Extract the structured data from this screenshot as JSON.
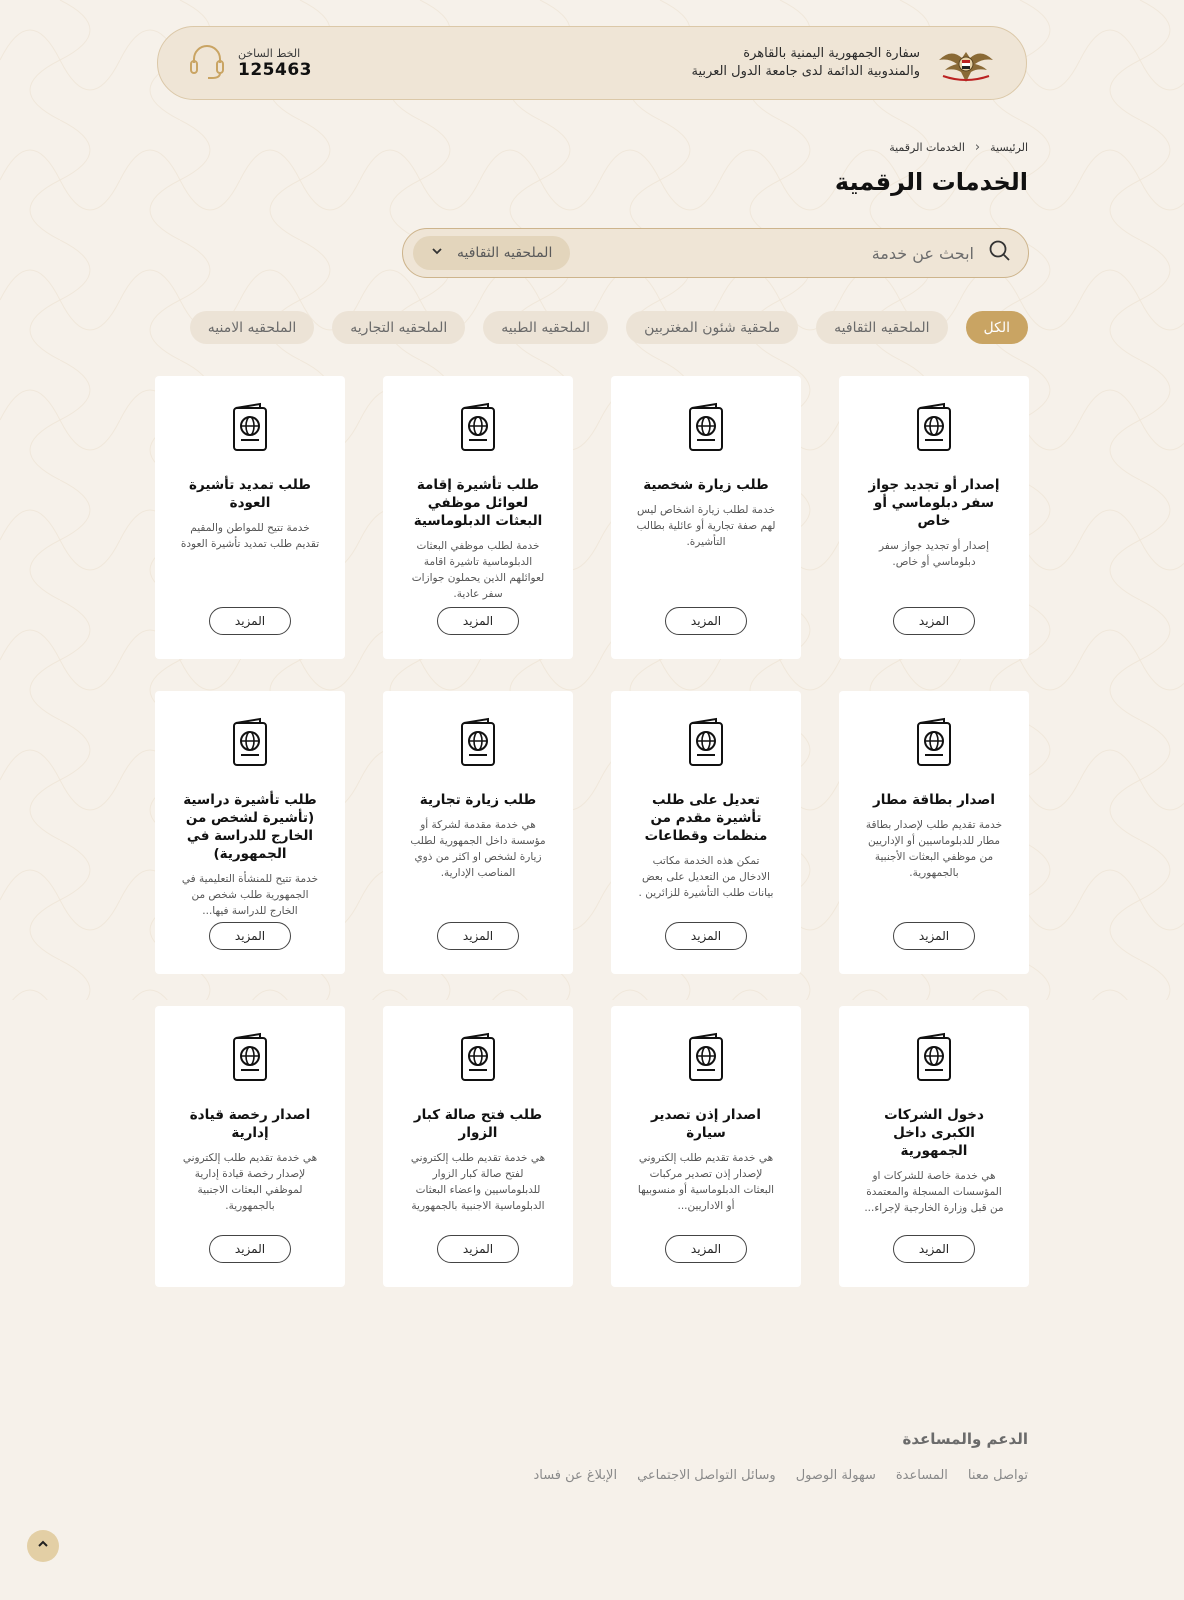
{
  "header": {
    "embassy_line1": "سفارة الجمهورية اليمنية بالقاهرة",
    "embassy_line2": "والمندوبية الدائمة لدى جامعة الدول العربية",
    "hotline_label": "الخط الساخن",
    "hotline_number": "125463"
  },
  "breadcrumb": {
    "home": "الرئيسية",
    "current": "الخدمات الرقمية"
  },
  "page_title": "الخدمات الرقمية",
  "search": {
    "placeholder": "ابحث عن خدمة",
    "selected_category": "الملحقيه الثقافيه"
  },
  "filters": [
    "الكل",
    "الملحقيه الثقافيه",
    "ملحقية شئون المغتربين",
    "الملحقيه الطبيه",
    "الملحقيه التجاريه",
    "الملحقيه الامنيه"
  ],
  "more_label": "المزيد",
  "cards": [
    {
      "title": "إصدار أو تجديد جواز سفر دبلوماسي أو خاص",
      "desc": "إصدار أو تجديد جواز سفر دبلوماسي أو خاص."
    },
    {
      "title": "طلب زيارة شخصية",
      "desc": "خدمة لطلب زيارة اشخاص ليس لهم صفة تجارية أو عائلية بطالب التأشيرة."
    },
    {
      "title": "طلب تأشيرة إقامة لعوائل موظفي البعثات الدبلوماسية",
      "desc": "خدمة لطلب موظفي البعثات الدبلوماسية تاشيرة اقامة لعوائلهم الذين يحملون جوازات سفر عادية."
    },
    {
      "title": "طلب تمديد تأشيرة العودة",
      "desc": "خدمة تتيح للمواطن والمقيم تقديم طلب تمديد تأشيرة العودة"
    },
    {
      "title": "اصدار بطاقة مطار",
      "desc": "خدمة تقديم طلب لإصدار بطاقة مطار للدبلوماسيين أو الإداريين من موظفي البعثات الأجنبية بالجمهورية."
    },
    {
      "title": "تعديل على طلب تأشيرة مقدم من منظمات وقطاعات",
      "desc": "تمكن هذه الخدمة مكاتب الادخال من التعديل على بعض بيانات طلب التأشيرة للزائرين ."
    },
    {
      "title": "طلب زيارة تجارية",
      "desc": "هي خدمة مقدمة لشركة أو مؤسسة داخل الجمهورية لطلب زيارة لشخص او اكثر من ذوي المناصب الإدارية."
    },
    {
      "title": "طلب تأشيرة دراسية (تأشيرة لشخص من الخارج للدراسة في الجمهورية)",
      "desc": "خدمة تتيح للمنشأة التعليمية في الجمهورية طلب شخص من الخارج للدراسة فيها..."
    },
    {
      "title": "دخول الشركات الكبرى داخل الجمهورية",
      "desc": "هي خدمة خاصة للشركات او المؤسسات المسجلة والمعتمدة من قبل وزارة الخارجية لإجراء..."
    },
    {
      "title": "اصدار إذن تصدير سيارة",
      "desc": "هي خدمة تقديم طلب إلكتروني لإصدار إذن تصدير مركبات البعثات الدبلوماسية أو منسوبيها أو الاداريين..."
    },
    {
      "title": "طلب فتح صالة كبار الزوار",
      "desc": "هي خدمة تقديم طلب إلكتروني لفتح صالة كبار الزوار للدبلوماسيين واعضاء البعثات الدبلوماسية الاجنبية بالجمهورية"
    },
    {
      "title": "اصدار رخصة قيادة إدارية",
      "desc": "هي خدمة تقديم طلب إلكتروني لإصدار رخصة قيادة إدارية لموظفي البعثات الاجنبية بالجمهورية."
    }
  ],
  "footer": {
    "title": "الدعم والمساعدة",
    "links": [
      "تواصل معنا",
      "المساعدة",
      "سهولة الوصول",
      "وسائل التواصل الاجتماعي",
      "الإبلاغ عن فساد"
    ]
  },
  "icons": {
    "card": "passport-icon",
    "search": "search-icon",
    "hotline": "headset-icon",
    "select": "chevron-down-icon",
    "to_top": "chevron-up-icon"
  },
  "colors": {
    "accent": "#c9a463",
    "background": "#f6f1ea",
    "header_bg": "#efe5d6"
  }
}
